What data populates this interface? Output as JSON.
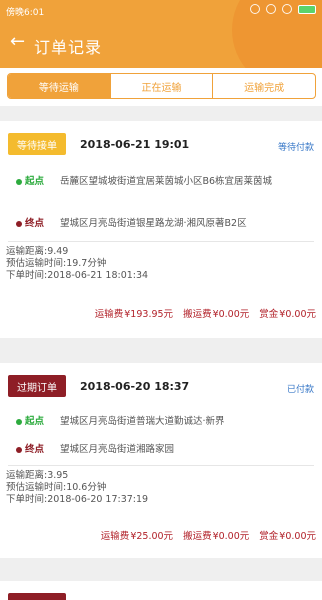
{
  "status_bar": {
    "time": "傍晚6:01"
  },
  "header": {
    "back_icon": "←",
    "title": "订单记录"
  },
  "tabs": [
    {
      "label": "等待运输",
      "active": true
    },
    {
      "label": "正在运输",
      "active": false
    },
    {
      "label": "运输完成",
      "active": false
    }
  ],
  "orders": [
    {
      "status_badge": "等待接单",
      "datetime": "2018-06-21 19:01",
      "payment_status": "等待付款",
      "origin_label": "起点",
      "origin": "岳麓区望城坡街道宜居莱茵城小区B6栋宜居莱茵城",
      "destination_label": "终点",
      "destination": "望城区月亮岛街道银星路龙湖·湘风原著B2区",
      "distance": "运输距离:9.49",
      "estimated_time": "预估运输时间:19.7分钟",
      "order_time": "下单时间:2018-06-21 18:01:34",
      "transport_fee_label": "运输费",
      "transport_fee": "¥193.95元",
      "moving_fee_label": "搬运费",
      "moving_fee": "¥0.00元",
      "reward_label": "赏金",
      "reward": "¥0.00元"
    },
    {
      "status_badge": "过期订单",
      "datetime": "2018-06-20 18:37",
      "payment_status": "已付款",
      "origin_label": "起点",
      "origin": "望城区月亮岛街道普瑞大道勤诚达·新界",
      "destination_label": "终点",
      "destination": "望城区月亮岛街道湘路家园",
      "distance": "运输距离:3.95",
      "estimated_time": "预估运输时间:10.6分钟",
      "order_time": "下单时间:2018-06-20 17:37:19",
      "transport_fee_label": "运输费",
      "transport_fee": "¥25.00元",
      "moving_fee_label": "搬运费",
      "moving_fee": "¥0.00元",
      "reward_label": "赏金",
      "reward": "¥0.00元"
    }
  ],
  "colors": {
    "accent": "#f0a23a",
    "badge_waiting": "#f4bb2e",
    "badge_expired": "#8e1e26",
    "origin_green": "#2dab3e",
    "fee_red": "#b2222a",
    "link_blue": "#3a79c8"
  }
}
